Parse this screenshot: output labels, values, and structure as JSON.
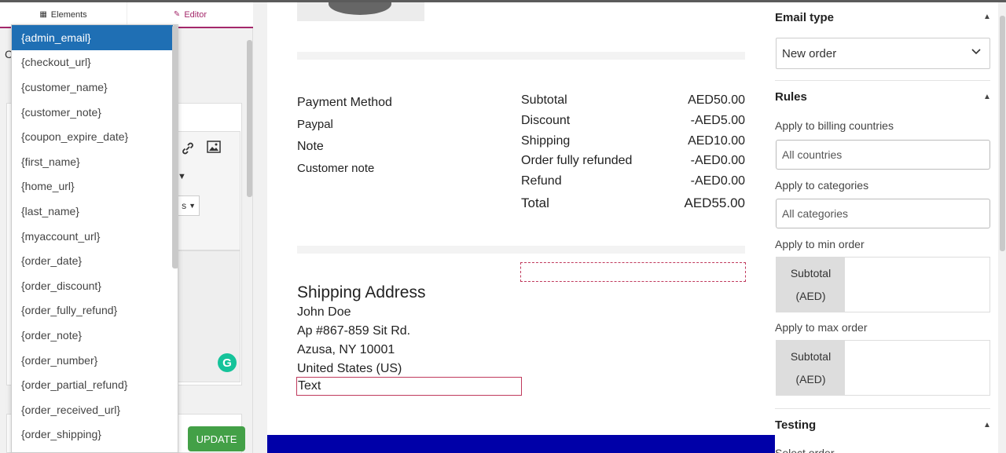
{
  "sidebar": {
    "tabs": {
      "elements": "Elements",
      "editor": "Editor"
    },
    "section_letter": "C",
    "select_suffix": "s",
    "grammarly_letter": "G",
    "update_label": "UPDATE"
  },
  "dropdown": {
    "items": [
      "{admin_email}",
      "{checkout_url}",
      "{customer_name}",
      "{customer_note}",
      "{coupon_expire_date}",
      "{first_name}",
      "{home_url}",
      "{last_name}",
      "{myaccount_url}",
      "{order_date}",
      "{order_discount}",
      "{order_fully_refund}",
      "{order_note}",
      "{order_number}",
      "{order_partial_refund}",
      "{order_received_url}",
      "{order_shipping}"
    ]
  },
  "canvas": {
    "payment": {
      "title": "Payment Method",
      "method": "Paypal",
      "note_title": "Note",
      "note": "Customer note"
    },
    "totals": [
      {
        "label": "Subtotal",
        "value": "AED50.00"
      },
      {
        "label": "Discount",
        "value": "-AED5.00"
      },
      {
        "label": "Shipping",
        "value": "AED10.00"
      },
      {
        "label": "Order fully refunded",
        "value": "-AED0.00"
      },
      {
        "label": "Refund",
        "value": "-AED0.00"
      },
      {
        "label": "Total",
        "value": "AED55.00"
      }
    ],
    "shipping": {
      "title": "Shipping Address",
      "lines": [
        "John Doe",
        "Ap #867-859 Sit Rd.",
        "Azusa, NY 10001",
        "United States (US)"
      ],
      "text_block": "Text"
    },
    "colors": {
      "footer_band": "#0000a8",
      "selection_border": "#c0395c"
    }
  },
  "right_panel": {
    "email_type": {
      "title": "Email type",
      "value": "New order"
    },
    "rules": {
      "title": "Rules",
      "billing_label": "Apply to billing countries",
      "billing_placeholder": "All countries",
      "categories_label": "Apply to categories",
      "categories_placeholder": "All categories",
      "min_label": "Apply to min order",
      "max_label": "Apply to max order",
      "subtotal": "Subtotal",
      "currency": "(AED)"
    },
    "testing": {
      "title": "Testing",
      "select_order": "Select order"
    }
  }
}
